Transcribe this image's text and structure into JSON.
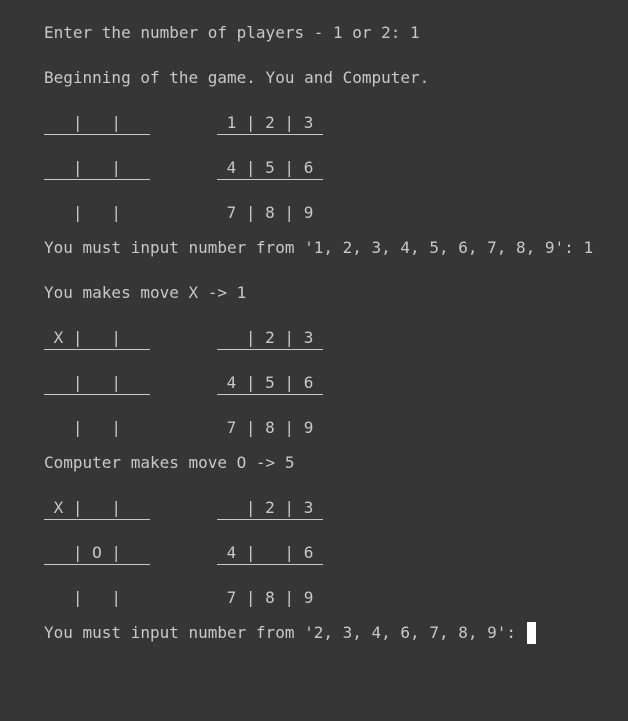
{
  "terminal": {
    "lines": [
      {
        "type": "text",
        "text": "Enter the number of players - 1 or 2: 1"
      },
      {
        "type": "text",
        "text": "Beginning of the game. You and Computer."
      },
      {
        "type": "boards",
        "game": [
          "   |   |",
          "   |   |",
          "   |   |"
        ],
        "keys": [
          " 1 | 2 | 3",
          " 4 | 5 | 6",
          " 7 | 8 | 9"
        ]
      },
      {
        "type": "text",
        "text": "You must input number from '1, 2, 3, 4, 5, 6, 7, 8, 9': 1"
      },
      {
        "type": "text",
        "text": "You makes move X -> 1"
      },
      {
        "type": "boards",
        "game": [
          " X |   |",
          "   |   |",
          "   |   |"
        ],
        "keys": [
          "   | 2 | 3",
          " 4 | 5 | 6",
          " 7 | 8 | 9"
        ]
      },
      {
        "type": "text",
        "text": "Computer makes move O -> 5"
      },
      {
        "type": "boards",
        "game": [
          " X |   |",
          "   | O |",
          "   |   |"
        ],
        "keys": [
          "   | 2 | 3",
          " 4 |   | 6",
          " 7 | 8 | 9"
        ]
      },
      {
        "type": "prompt",
        "text": "You must input number from '2, 3, 4, 6, 7, 8, 9': "
      }
    ]
  }
}
